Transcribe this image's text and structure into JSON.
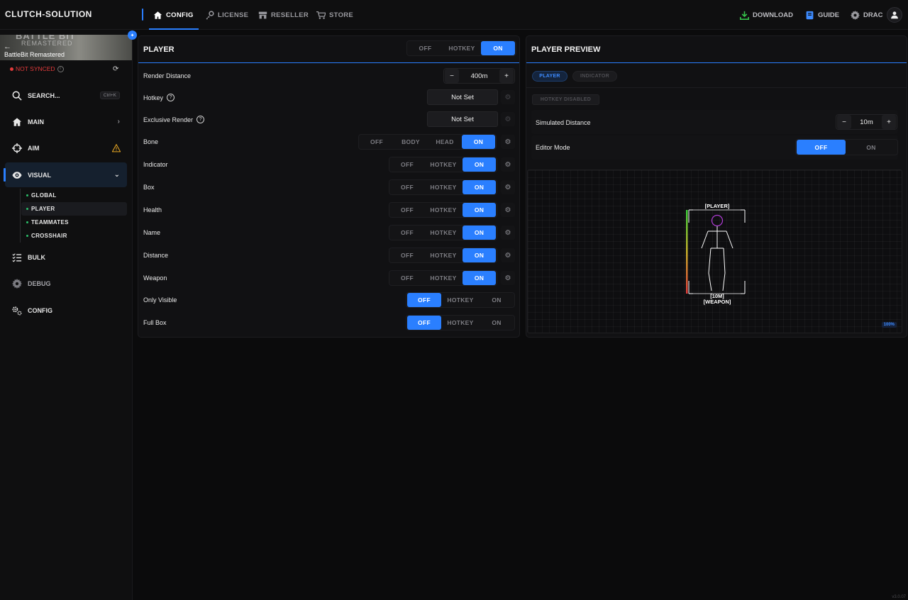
{
  "app": {
    "brand": "CLUTCH-SOLUTION",
    "version": "v3.0.07"
  },
  "topnav": {
    "tabs": [
      {
        "label": "CONFIG",
        "icon": "home-icon",
        "active": true
      },
      {
        "label": "LICENSE",
        "icon": "key-icon"
      },
      {
        "label": "RESELLER",
        "icon": "store-icon"
      },
      {
        "label": "STORE",
        "icon": "cart-icon"
      }
    ],
    "download": "DOWNLOAD",
    "guide": "GUIDE",
    "user": "DRAC"
  },
  "sidebar": {
    "game_title": "BattleBit Remastered",
    "banner_logo": "BATTLE BIT",
    "banner_sub": "REMASTERED",
    "sync_status": "NOT SYNCED",
    "search_label": "SEARCH...",
    "search_shortcut": "Ctrl+K",
    "items": [
      {
        "label": "MAIN",
        "icon": "home-icon"
      },
      {
        "label": "AIM",
        "icon": "crosshair-icon"
      },
      {
        "label": "VISUAL",
        "icon": "eye-icon",
        "active": true
      },
      {
        "label": "BULK",
        "icon": "list-check-icon"
      },
      {
        "label": "DEBUG",
        "icon": "gear-icon"
      },
      {
        "label": "CONFIG",
        "icon": "gears-icon"
      }
    ],
    "visual_sub": [
      "GLOBAL",
      "PLAYER",
      "TEAMMATES",
      "CROSSHAIR"
    ]
  },
  "player_panel": {
    "title": "PLAYER",
    "master_toggle": {
      "options": [
        "OFF",
        "HOTKEY",
        "ON"
      ],
      "selected": "ON"
    },
    "render_distance": {
      "label": "Render Distance",
      "value": "400m",
      "minus": "−",
      "plus": "+"
    },
    "hotkey": {
      "label": "Hotkey",
      "value": "Not Set"
    },
    "exclusive_render": {
      "label": "Exclusive Render",
      "value": "Not Set"
    },
    "bone": {
      "label": "Bone",
      "options": [
        "OFF",
        "BODY",
        "HEAD",
        "ON"
      ],
      "selected": "ON"
    },
    "rows": [
      {
        "label": "Indicator",
        "options": [
          "OFF",
          "HOTKEY",
          "ON"
        ],
        "selected": "ON"
      },
      {
        "label": "Box",
        "options": [
          "OFF",
          "HOTKEY",
          "ON"
        ],
        "selected": "ON"
      },
      {
        "label": "Health",
        "options": [
          "OFF",
          "HOTKEY",
          "ON"
        ],
        "selected": "ON"
      },
      {
        "label": "Name",
        "options": [
          "OFF",
          "HOTKEY",
          "ON"
        ],
        "selected": "ON"
      },
      {
        "label": "Distance",
        "options": [
          "OFF",
          "HOTKEY",
          "ON"
        ],
        "selected": "ON"
      },
      {
        "label": "Weapon",
        "options": [
          "OFF",
          "HOTKEY",
          "ON"
        ],
        "selected": "ON"
      }
    ],
    "only_visible": {
      "label": "Only Visible",
      "options": [
        "OFF",
        "HOTKEY",
        "ON"
      ],
      "selected": "OFF"
    },
    "full_box": {
      "label": "Full Box",
      "options": [
        "OFF",
        "HOTKEY",
        "ON"
      ],
      "selected": "OFF"
    }
  },
  "preview_panel": {
    "title": "PLAYER PREVIEW",
    "tabs": [
      "PLAYER",
      "INDICATOR"
    ],
    "hotkey_status": "HOTKEY DISABLED",
    "simulated_distance": {
      "label": "Simulated Distance",
      "value": "10m",
      "minus": "−",
      "plus": "+"
    },
    "editor_mode": {
      "label": "Editor Mode",
      "options": [
        "OFF",
        "ON"
      ],
      "selected": "OFF"
    },
    "preview": {
      "name_tag": "[PLAYER]",
      "distance_tag": "[10M]",
      "weapon_tag": "[WEAPON]",
      "zoom": "100%",
      "health": 1.0
    },
    "colors": {
      "accent": "#2a7fff",
      "head_circle": "#b03cd6",
      "health_top": "#3ad13a",
      "health_bottom": "#e23b3b"
    }
  }
}
